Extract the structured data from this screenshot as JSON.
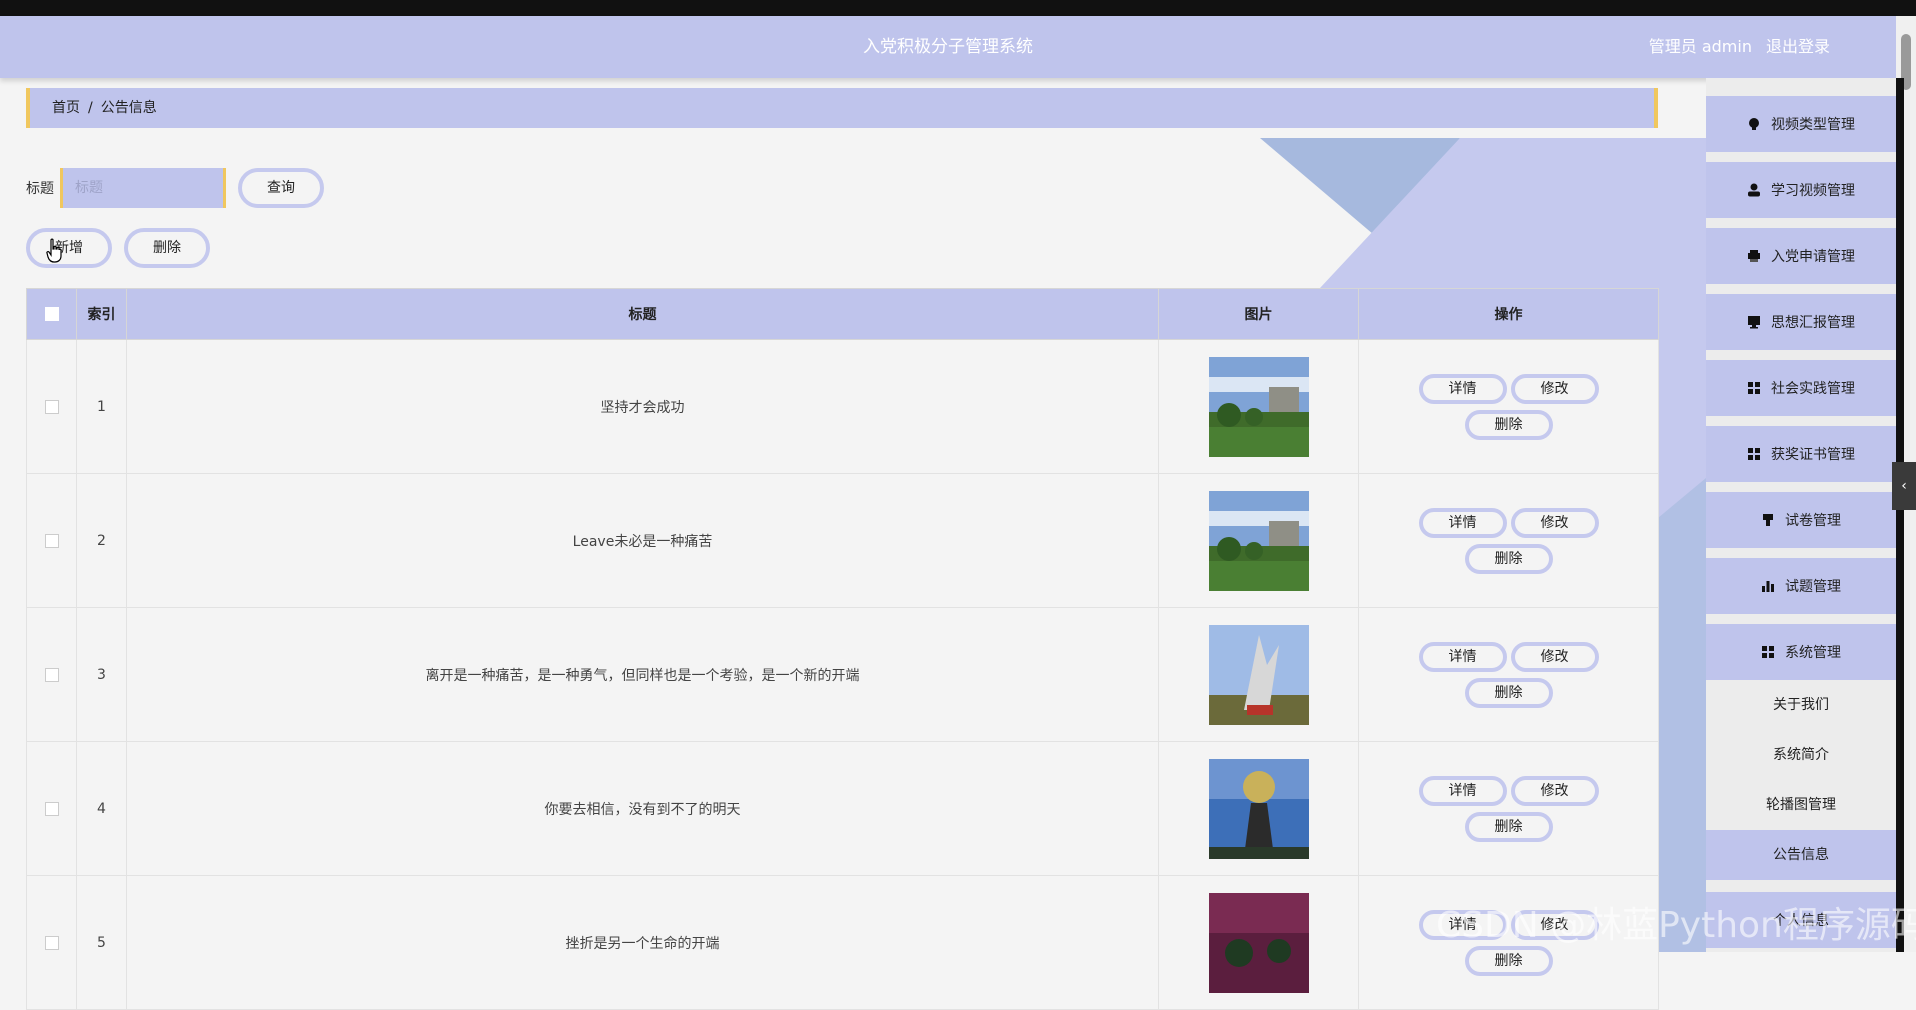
{
  "header": {
    "title": "入党积极分子管理系统",
    "user_label": "管理员 admin",
    "logout_label": "退出登录"
  },
  "breadcrumb": {
    "home": "首页",
    "separator": "/",
    "current": "公告信息"
  },
  "search": {
    "label": "标题",
    "placeholder": "标题",
    "value": "",
    "button_label": "查询"
  },
  "actions": {
    "add_label": "新增",
    "delete_label": "删除"
  },
  "table": {
    "columns": [
      "索引",
      "标题",
      "图片",
      "操作"
    ],
    "rows": [
      {
        "index": "1",
        "title": "坚持才会成功",
        "image": "campus-photo"
      },
      {
        "index": "2",
        "title": "Leave未必是一种痛苦",
        "image": "campus-photo"
      },
      {
        "index": "3",
        "title": "离开是一种痛苦，是一种勇气，但同样也是一个考验，是一个新的开端",
        "image": "sculpture-photo"
      },
      {
        "index": "4",
        "title": "你要去相信，没有到不了的明天",
        "image": "globe-sculpture-photo"
      },
      {
        "index": "5",
        "title": "挫折是另一个生命的开端",
        "image": "night-campus-photo"
      }
    ],
    "row_actions": {
      "detail": "详情",
      "edit": "修改",
      "delete": "删除"
    }
  },
  "sidebar": {
    "items": [
      {
        "label": "视频类型管理",
        "icon": "bulb-icon"
      },
      {
        "label": "学习视频管理",
        "icon": "user-icon"
      },
      {
        "label": "入党申请管理",
        "icon": "printer-icon"
      },
      {
        "label": "思想汇报管理",
        "icon": "monitor-icon"
      },
      {
        "label": "社会实践管理",
        "icon": "grid-icon"
      },
      {
        "label": "获奖证书管理",
        "icon": "grid-icon"
      },
      {
        "label": "试卷管理",
        "icon": "flag-icon"
      },
      {
        "label": "试题管理",
        "icon": "bar-chart-icon"
      },
      {
        "label": "系统管理",
        "icon": "grid-icon"
      }
    ],
    "sub_items": [
      "关于我们",
      "系统简介",
      "轮播图管理",
      "公告信息"
    ],
    "partial_item": "个人信息"
  },
  "watermark": "CSDN @林蓝Python程序源码",
  "colors": {
    "accent": "#bfc4ec",
    "border_accent": "#f0c75e",
    "pill_border": "#c5c9ee"
  }
}
